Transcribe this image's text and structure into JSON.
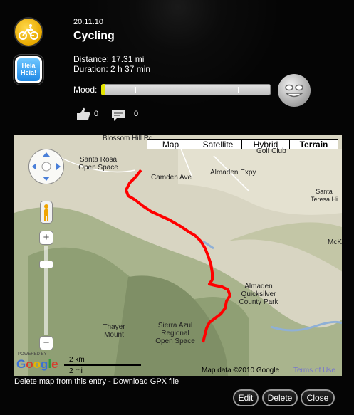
{
  "entry": {
    "date": "20.11.10",
    "title": "Cycling",
    "distance": "Distance: 17.31 mi",
    "duration": "Duration: 2 h 37 min",
    "mood_label": "Mood:",
    "mood_level": 0.02,
    "likes": "0",
    "comments": "0",
    "app_icon_text": "Heia Heia!"
  },
  "map": {
    "types": [
      "Map",
      "Satellite",
      "Hybrid",
      "Terrain"
    ],
    "selected_type": "Terrain",
    "places": {
      "blossom_hill": "Blossom Hill Rd",
      "santa_rosa": "Santa Rosa Open Space",
      "camden": "Camden Ave",
      "almaden_expy": "Almaden Expy",
      "golf_club": "Golf Club",
      "santa_teresa": "Santa Teresa Hi",
      "almaden_quicksilver": "Almaden Quicksilver County Park",
      "thayer": "Thayer Mount",
      "sierra_azul": "Sierra Azul Regional Open Space",
      "mck": "McK"
    },
    "powered_by": "POWERED BY",
    "google": "Google",
    "scale_km": "2 km",
    "scale_mi": "2 mi",
    "credit": "Map data ©2010 Google",
    "terms": "Terms of Use"
  },
  "links": {
    "delete_map": "Delete map from this entry",
    "separator": " - ",
    "download_gpx": "Download GPX file"
  },
  "buttons": {
    "edit": "Edit",
    "delete": "Delete",
    "close": "Close"
  },
  "colors": {
    "route": "#ff0000",
    "mood_fill": "#e4e400",
    "sport_icon": "#f2c200"
  },
  "icons": [
    "cycling-icon",
    "heia-app-icon",
    "smiley-icon",
    "thumbs-up-icon",
    "comment-icon",
    "pan-control-icon",
    "pegman-icon"
  ]
}
